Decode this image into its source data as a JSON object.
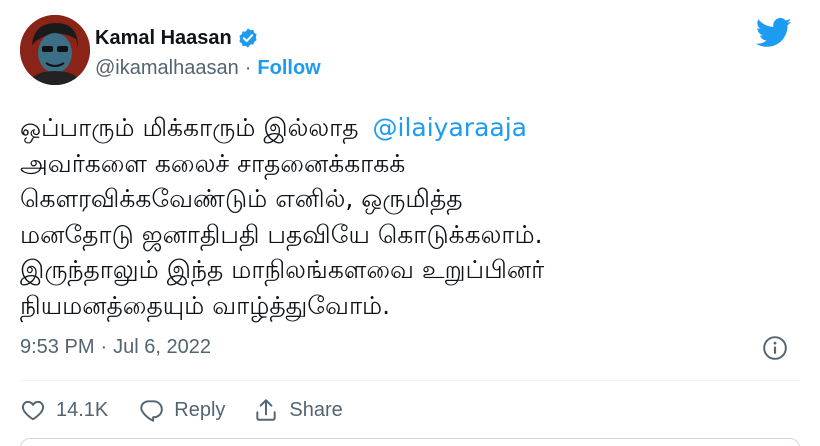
{
  "author": {
    "display_name": "Kamal Haasan",
    "handle": "@ikamalhaasan",
    "separator": "·",
    "follow_label": "Follow",
    "verified_icon": "verified-badge-icon",
    "avatar_icon": "avatar"
  },
  "brand": {
    "icon": "twitter-bird-icon",
    "color": "#1d9bf0"
  },
  "tweet": {
    "line1": "ஒப்பாரும் மிக்காரும் இல்லாத",
    "mention": "@ilaiyaraaja",
    "line2": "அவர்களை கலைச் சாதனைக்காகக்",
    "line3": "கௌரவிக்கவேண்டும் எனில், ஒருமித்த",
    "line4": "மனதோடு ஜனாதிபதி பதவியே கொடுக்கலாம்.",
    "line5": "இருந்தாலும் இந்த மாநிலங்களவை உறுப்பினர்",
    "line6": "நியமனத்தையும் வாழ்த்துவோம்."
  },
  "meta": {
    "time": "9:53 PM",
    "separator": "·",
    "date": "Jul 6, 2022",
    "info_icon": "info-icon"
  },
  "actions": {
    "like_icon": "heart-icon",
    "like_count": "14.1K",
    "reply_icon": "reply-icon",
    "reply_label": "Reply",
    "share_icon": "share-icon",
    "share_label": "Share"
  },
  "colors": {
    "text": "#0f1419",
    "secondary": "#536471",
    "accent": "#1d9bf0"
  }
}
